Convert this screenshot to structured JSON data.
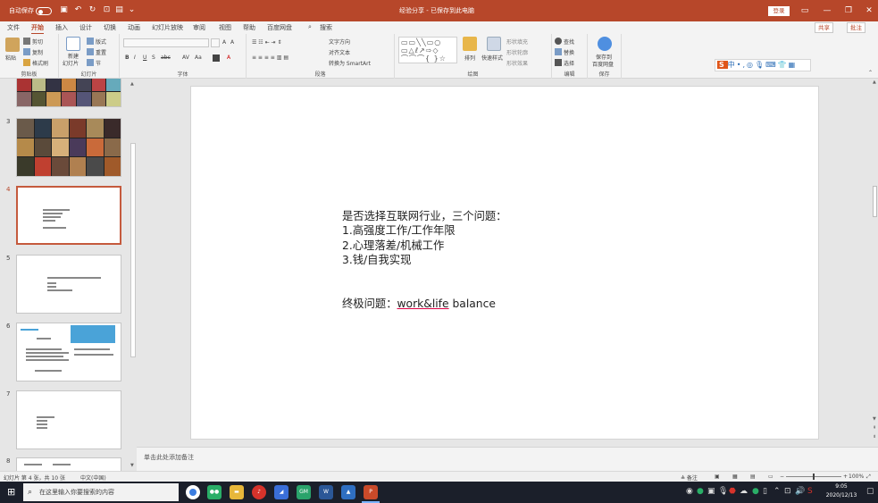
{
  "titlebar": {
    "autosave_label": "自动保存",
    "autosave_state": "●关",
    "doc_title": "经验分享 - 已保存到此电脑",
    "signin_label": "登录",
    "undo_icon": "undo-icon",
    "save_icon": "save-icon"
  },
  "tabs": [
    "文件",
    "开始",
    "插入",
    "设计",
    "切换",
    "动画",
    "幻灯片放映",
    "审阅",
    "视图",
    "帮助",
    "百度网盘",
    "搜索"
  ],
  "active_tab": "开始",
  "tab_actions": {
    "share": "共享",
    "comment": "批注"
  },
  "ribbon": {
    "clipboard": {
      "paste": "粘贴",
      "cut": "剪切",
      "copy": "复制",
      "format_painter": "格式刷",
      "label": "剪贴板"
    },
    "slides": {
      "new_slide": "新建",
      "new_slide2": "幻灯片",
      "layout": "版式",
      "reset": "重置",
      "section": "节",
      "label": "幻灯片"
    },
    "font": {
      "bold": "B",
      "italic": "I",
      "underline": "U",
      "strike": "S",
      "shadow": "abc",
      "spacing": "AV",
      "case": "Aa",
      "size_up": "A",
      "size_down": "A",
      "label": "字体"
    },
    "paragraph": {
      "text_direction": "文字方向",
      "align_text": "对齐文本",
      "smartart": "转换为 SmartArt",
      "label": "段落"
    },
    "drawing": {
      "arrange": "排列",
      "quick_styles": "快速样式",
      "shape_fill": "形状填充",
      "shape_outline": "形状轮廓",
      "shape_effects": "形状效果",
      "label": "绘图"
    },
    "editing": {
      "find": "查找",
      "replace": "替换",
      "select": "选择",
      "label": "编辑"
    },
    "save": {
      "save_to_baidu": "保存到",
      "save_to_baidu2": "百度网盘",
      "label": "保存"
    }
  },
  "ime_bar": {
    "logo": "S",
    "items": "中•,◎🎙⌨👕▦"
  },
  "thumbnails": [
    {
      "num": "3",
      "active": false
    },
    {
      "num": "4",
      "active": true
    },
    {
      "num": "5",
      "active": false
    },
    {
      "num": "6",
      "active": false
    },
    {
      "num": "7",
      "active": false
    },
    {
      "num": "8",
      "active": false
    }
  ],
  "slide": {
    "lines": [
      "是否选择互联网行业，三个问题：",
      "1.高强度工作/工作年限",
      "2.心理落差/机械工作",
      "3.钱/自我实现"
    ],
    "final_prefix": "终极问题：",
    "final_underlined": "work&life",
    "final_suffix": " balance"
  },
  "notes_placeholder": "单击此处添加备注",
  "status": {
    "slide_count": "幻灯片 第 4 张，共 10 张",
    "language": "中文(中国)",
    "notes_btn": "≜ 备注",
    "zoom": "100%"
  },
  "taskbar": {
    "search_placeholder": "在这里输入你要搜索的内容",
    "time": "9:05",
    "date": "2020/12/13"
  }
}
